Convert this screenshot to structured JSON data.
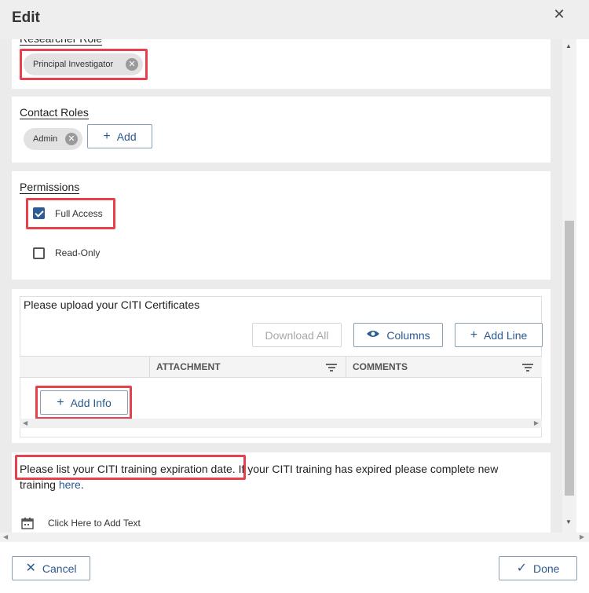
{
  "dialog": {
    "title": "Edit",
    "close_icon": "✕"
  },
  "researcher_role": {
    "label": "Researcher Role",
    "chips": [
      {
        "text": "Principal Investigator"
      }
    ]
  },
  "contact_roles": {
    "label": "Contact Roles",
    "chips": [
      {
        "text": "Admin"
      }
    ],
    "add_label": "Add"
  },
  "permissions": {
    "label": "Permissions",
    "options": [
      {
        "label": "Full Access",
        "checked": true
      },
      {
        "label": "Read-Only",
        "checked": false
      }
    ]
  },
  "citi_upload": {
    "title": "Please upload your CITI Certificates",
    "download_all": "Download All",
    "columns": "Columns",
    "add_line": "Add Line",
    "headers": [
      "ATTACHMENT",
      "COMMENTS"
    ],
    "add_info": "Add Info"
  },
  "citi_training": {
    "text_highlighted": "Please list your CITI training expiration date.",
    "text_rest_line1": " If your CITI training has expired please complete new",
    "text_line2_prefix": "training ",
    "link_text": "here",
    "text_line2_suffix": ".",
    "add_text_placeholder": "Click Here to Add Text"
  },
  "footer": {
    "cancel": "Cancel",
    "done": "Done"
  },
  "colors": {
    "accent": "#2b5a8f",
    "highlight": "#e8414e",
    "checkbox": "#2c5c93"
  }
}
